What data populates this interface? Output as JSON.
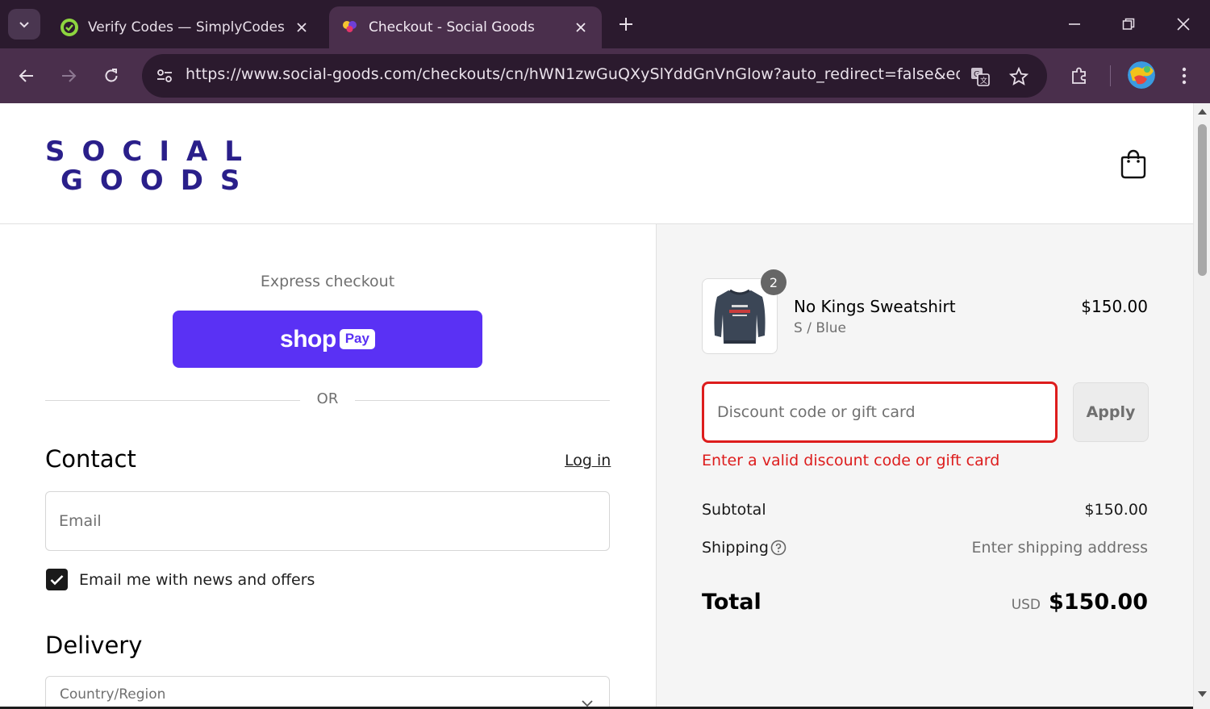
{
  "browser": {
    "tabs": [
      {
        "title": "Verify Codes — SimplyCodes",
        "active": false
      },
      {
        "title": "Checkout - Social Goods",
        "active": true
      }
    ],
    "url": "https://www.social-goods.com/checkouts/cn/hWN1zwGuQXySlYddGnVnGlow?auto_redirect=false&edge_..."
  },
  "header": {
    "logo_line1": "SOCIAL",
    "logo_line2": "GOODS",
    "brand_color": "#2a1f8a"
  },
  "express": {
    "label": "Express checkout",
    "shop_pay_shop": "shop",
    "shop_pay_pay": "Pay",
    "or": "OR"
  },
  "contact": {
    "heading": "Contact",
    "login": "Log in",
    "email_placeholder": "Email",
    "newsletter_label": "Email me with news and offers",
    "newsletter_checked": true
  },
  "delivery": {
    "heading": "Delivery",
    "country_label": "Country/Region"
  },
  "order": {
    "product_name": "No Kings Sweatshirt",
    "variant": "S / Blue",
    "quantity": "2",
    "price": "$150.00"
  },
  "discount": {
    "placeholder": "Discount code or gift card",
    "apply": "Apply",
    "error": "Enter a valid discount code or gift card",
    "error_color": "#dd1d1d"
  },
  "totals": {
    "subtotal_label": "Subtotal",
    "subtotal_value": "$150.00",
    "shipping_label": "Shipping",
    "shipping_value": "Enter shipping address",
    "total_label": "Total",
    "currency": "USD",
    "total_value": "$150.00"
  },
  "colors": {
    "shop_pay": "#5a31f4",
    "chrome_dark": "#2b1a2e",
    "chrome_toolbar": "#4a2f4c"
  }
}
